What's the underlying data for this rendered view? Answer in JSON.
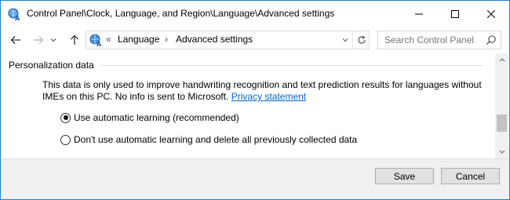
{
  "window": {
    "title": "Control Panel\\Clock, Language, and Region\\Language\\Advanced settings",
    "app_icon": "control-panel-language-icon",
    "controls": [
      "minimize",
      "maximize",
      "close"
    ]
  },
  "nav": {
    "back_icon": "arrow-left",
    "forward_icon": "arrow-right",
    "recent_icon": "chevron-down",
    "up_icon": "arrow-up",
    "address": {
      "overflow": "«",
      "crumbs": [
        "Language",
        "Advanced settings"
      ],
      "separator": "›"
    },
    "search_placeholder": "Search Control Panel"
  },
  "section": {
    "title": "Personalization data",
    "description": "This data is only used to improve handwriting recognition and text prediction results for languages without IMEs on this PC. No info is sent to Microsoft.",
    "privacy_link": "Privacy statement"
  },
  "options": [
    {
      "label": "Use automatic learning (recommended)",
      "selected": true
    },
    {
      "label": "Don't use automatic learning and delete all previously collected data",
      "selected": false
    }
  ],
  "buttons": {
    "save": "Save",
    "cancel": "Cancel"
  },
  "colors": {
    "window_border": "#1883d7",
    "link": "#0066cc",
    "footer_bg": "#f0f0f0"
  }
}
